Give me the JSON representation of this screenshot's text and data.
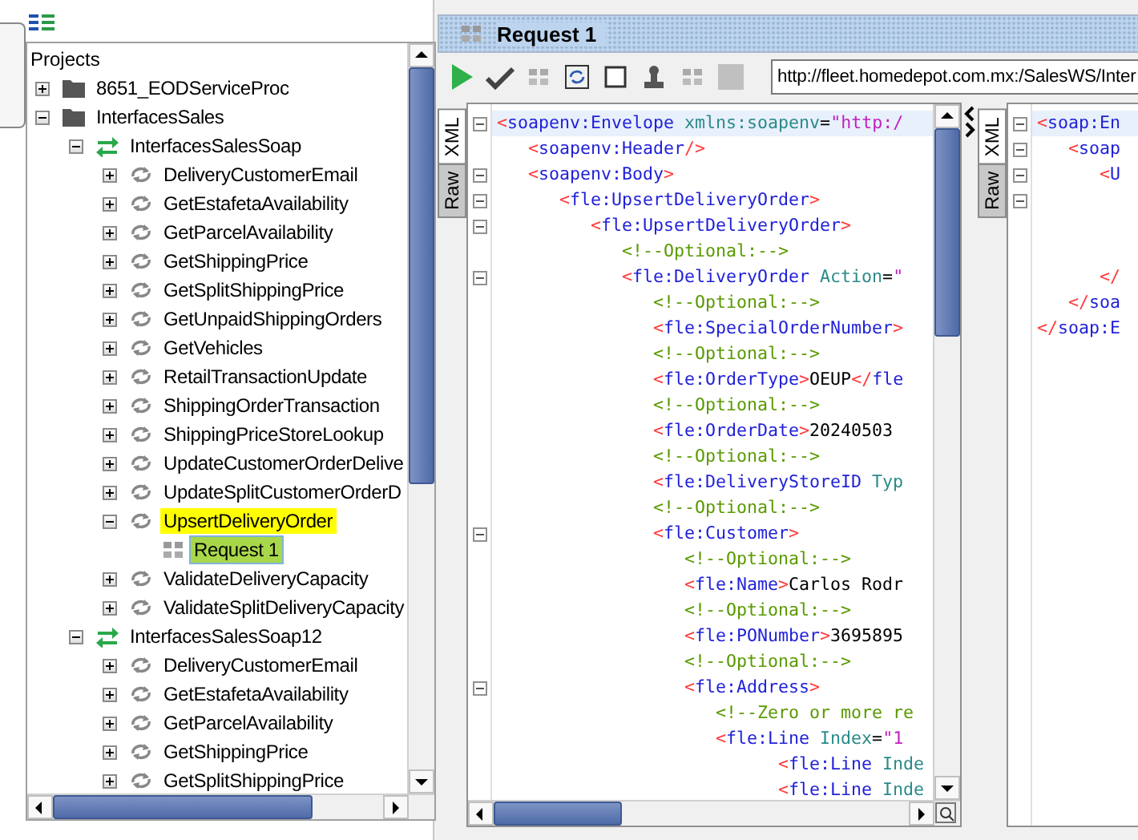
{
  "navigator": {
    "root_label": "Projects",
    "items": [
      {
        "label": "8651_EODServiceProc",
        "kind": "folder",
        "expanded": false,
        "selected": false,
        "highlighted": false
      },
      {
        "label": "InterfacesSales",
        "kind": "folder",
        "expanded": true,
        "selected": false,
        "highlighted": false,
        "children": [
          {
            "label": "InterfacesSalesSoap",
            "kind": "interface",
            "expanded": true,
            "selected": false,
            "highlighted": false,
            "children": [
              {
                "label": "DeliveryCustomerEmail",
                "kind": "operation",
                "expanded": false,
                "selected": false,
                "highlighted": false
              },
              {
                "label": "GetEstafetaAvailability",
                "kind": "operation",
                "expanded": false,
                "selected": false,
                "highlighted": false
              },
              {
                "label": "GetParcelAvailability",
                "kind": "operation",
                "expanded": false,
                "selected": false,
                "highlighted": false
              },
              {
                "label": "GetShippingPrice",
                "kind": "operation",
                "expanded": false,
                "selected": false,
                "highlighted": false
              },
              {
                "label": "GetSplitShippingPrice",
                "kind": "operation",
                "expanded": false,
                "selected": false,
                "highlighted": false
              },
              {
                "label": "GetUnpaidShippingOrders",
                "kind": "operation",
                "expanded": false,
                "selected": false,
                "highlighted": false
              },
              {
                "label": "GetVehicles",
                "kind": "operation",
                "expanded": false,
                "selected": false,
                "highlighted": false
              },
              {
                "label": "RetailTransactionUpdate",
                "kind": "operation",
                "expanded": false,
                "selected": false,
                "highlighted": false
              },
              {
                "label": "ShippingOrderTransaction",
                "kind": "operation",
                "expanded": false,
                "selected": false,
                "highlighted": false
              },
              {
                "label": "ShippingPriceStoreLookup",
                "kind": "operation",
                "expanded": false,
                "selected": false,
                "highlighted": false
              },
              {
                "label": "UpdateCustomerOrderDelive",
                "kind": "operation",
                "expanded": false,
                "selected": false,
                "highlighted": false
              },
              {
                "label": "UpdateSplitCustomerOrderD",
                "kind": "operation",
                "expanded": false,
                "selected": false,
                "highlighted": false
              },
              {
                "label": "UpsertDeliveryOrder",
                "kind": "operation",
                "expanded": true,
                "selected": false,
                "highlighted": true,
                "children": [
                  {
                    "label": "Request 1",
                    "kind": "request",
                    "selected": true,
                    "highlighted": true
                  }
                ]
              },
              {
                "label": "ValidateDeliveryCapacity",
                "kind": "operation",
                "expanded": false,
                "selected": false,
                "highlighted": false
              },
              {
                "label": "ValidateSplitDeliveryCapacity",
                "kind": "operation",
                "expanded": false,
                "selected": false,
                "highlighted": false
              }
            ]
          },
          {
            "label": "InterfacesSalesSoap12",
            "kind": "interface",
            "expanded": true,
            "selected": false,
            "highlighted": false,
            "children": [
              {
                "label": "DeliveryCustomerEmail",
                "kind": "operation",
                "expanded": false,
                "selected": false,
                "highlighted": false
              },
              {
                "label": "GetEstafetaAvailability",
                "kind": "operation",
                "expanded": false,
                "selected": false,
                "highlighted": false
              },
              {
                "label": "GetParcelAvailability",
                "kind": "operation",
                "expanded": false,
                "selected": false,
                "highlighted": false
              },
              {
                "label": "GetShippingPrice",
                "kind": "operation",
                "expanded": false,
                "selected": false,
                "highlighted": false
              },
              {
                "label": "GetSplitShippingPrice",
                "kind": "operation",
                "expanded": false,
                "selected": false,
                "highlighted": false
              }
            ]
          }
        ]
      }
    ]
  },
  "editor_tab": {
    "title": "Request 1"
  },
  "toolbar": {
    "url": "http://fleet.homedepot.com.mx:/SalesWS/Inter"
  },
  "request_pane": {
    "side_tabs": [
      {
        "label": "XML",
        "selected": true
      },
      {
        "label": "Raw",
        "selected": false
      }
    ],
    "lines": [
      {
        "fold": true,
        "current": true,
        "tokens": [
          {
            "kind": "bracket",
            "text": "<"
          },
          {
            "kind": "tag",
            "text": "soapenv:Envelope"
          },
          {
            "kind": "attr",
            "text": " xmlns:soapenv"
          },
          {
            "kind": "plain",
            "text": "="
          },
          {
            "kind": "value",
            "text": "\"http:/"
          }
        ]
      },
      {
        "fold": false,
        "current": false,
        "tokens": [
          {
            "kind": "bracket",
            "text": "   <"
          },
          {
            "kind": "tag",
            "text": "soapenv:Header"
          },
          {
            "kind": "bracket",
            "text": "/>"
          }
        ]
      },
      {
        "fold": true,
        "current": false,
        "tokens": [
          {
            "kind": "bracket",
            "text": "   <"
          },
          {
            "kind": "tag",
            "text": "soapenv:Body"
          },
          {
            "kind": "bracket",
            "text": ">"
          }
        ]
      },
      {
        "fold": true,
        "current": false,
        "tokens": [
          {
            "kind": "bracket",
            "text": "      <"
          },
          {
            "kind": "tag",
            "text": "fle:UpsertDeliveryOrder"
          },
          {
            "kind": "bracket",
            "text": ">"
          }
        ]
      },
      {
        "fold": true,
        "current": false,
        "tokens": [
          {
            "kind": "bracket",
            "text": "         <"
          },
          {
            "kind": "tag",
            "text": "fle:UpsertDeliveryOrder"
          },
          {
            "kind": "bracket",
            "text": ">"
          }
        ]
      },
      {
        "fold": false,
        "current": false,
        "tokens": [
          {
            "kind": "comment",
            "text": "            <!--Optional:-->"
          }
        ]
      },
      {
        "fold": true,
        "current": false,
        "tokens": [
          {
            "kind": "bracket",
            "text": "            <"
          },
          {
            "kind": "tag",
            "text": "fle:DeliveryOrder"
          },
          {
            "kind": "attr",
            "text": " Action"
          },
          {
            "kind": "plain",
            "text": "="
          },
          {
            "kind": "value",
            "text": "\""
          }
        ]
      },
      {
        "fold": false,
        "current": false,
        "tokens": [
          {
            "kind": "comment",
            "text": "               <!--Optional:-->"
          }
        ]
      },
      {
        "fold": false,
        "current": false,
        "tokens": [
          {
            "kind": "bracket",
            "text": "               <"
          },
          {
            "kind": "tag",
            "text": "fle:SpecialOrderNumber"
          },
          {
            "kind": "bracket",
            "text": ">"
          }
        ]
      },
      {
        "fold": false,
        "current": false,
        "tokens": [
          {
            "kind": "comment",
            "text": "               <!--Optional:-->"
          }
        ]
      },
      {
        "fold": false,
        "current": false,
        "tokens": [
          {
            "kind": "bracket",
            "text": "               <"
          },
          {
            "kind": "tag",
            "text": "fle:OrderType"
          },
          {
            "kind": "bracket",
            "text": ">"
          },
          {
            "kind": "plain",
            "text": "OEUP"
          },
          {
            "kind": "bracket",
            "text": "</"
          },
          {
            "kind": "tag",
            "text": "fle"
          }
        ]
      },
      {
        "fold": false,
        "current": false,
        "tokens": [
          {
            "kind": "comment",
            "text": "               <!--Optional:-->"
          }
        ]
      },
      {
        "fold": false,
        "current": false,
        "tokens": [
          {
            "kind": "bracket",
            "text": "               <"
          },
          {
            "kind": "tag",
            "text": "fle:OrderDate"
          },
          {
            "kind": "bracket",
            "text": ">"
          },
          {
            "kind": "plain",
            "text": "20240503"
          }
        ]
      },
      {
        "fold": false,
        "current": false,
        "tokens": [
          {
            "kind": "comment",
            "text": "               <!--Optional:-->"
          }
        ]
      },
      {
        "fold": false,
        "current": false,
        "tokens": [
          {
            "kind": "bracket",
            "text": "               <"
          },
          {
            "kind": "tag",
            "text": "fle:DeliveryStoreID"
          },
          {
            "kind": "attr",
            "text": " Typ"
          }
        ]
      },
      {
        "fold": false,
        "current": false,
        "tokens": [
          {
            "kind": "comment",
            "text": "               <!--Optional:-->"
          }
        ]
      },
      {
        "fold": true,
        "current": false,
        "tokens": [
          {
            "kind": "bracket",
            "text": "               <"
          },
          {
            "kind": "tag",
            "text": "fle:Customer"
          },
          {
            "kind": "bracket",
            "text": ">"
          }
        ]
      },
      {
        "fold": false,
        "current": false,
        "tokens": [
          {
            "kind": "comment",
            "text": "                  <!--Optional:-->"
          }
        ]
      },
      {
        "fold": false,
        "current": false,
        "tokens": [
          {
            "kind": "bracket",
            "text": "                  <"
          },
          {
            "kind": "tag",
            "text": "fle:Name"
          },
          {
            "kind": "bracket",
            "text": ">"
          },
          {
            "kind": "plain",
            "text": "Carlos Rodr"
          }
        ]
      },
      {
        "fold": false,
        "current": false,
        "tokens": [
          {
            "kind": "comment",
            "text": "                  <!--Optional:-->"
          }
        ]
      },
      {
        "fold": false,
        "current": false,
        "tokens": [
          {
            "kind": "bracket",
            "text": "                  <"
          },
          {
            "kind": "tag",
            "text": "fle:PONumber"
          },
          {
            "kind": "bracket",
            "text": ">"
          },
          {
            "kind": "plain",
            "text": "3695895"
          }
        ]
      },
      {
        "fold": false,
        "current": false,
        "tokens": [
          {
            "kind": "comment",
            "text": "                  <!--Optional:-->"
          }
        ]
      },
      {
        "fold": true,
        "current": false,
        "tokens": [
          {
            "kind": "bracket",
            "text": "                  <"
          },
          {
            "kind": "tag",
            "text": "fle:Address"
          },
          {
            "kind": "bracket",
            "text": ">"
          }
        ]
      },
      {
        "fold": false,
        "current": false,
        "tokens": [
          {
            "kind": "comment",
            "text": "                     <!--Zero or more re"
          }
        ]
      },
      {
        "fold": false,
        "current": false,
        "tokens": [
          {
            "kind": "bracket",
            "text": "                     <"
          },
          {
            "kind": "tag",
            "text": "fle:Line"
          },
          {
            "kind": "attr",
            "text": " Index"
          },
          {
            "kind": "plain",
            "text": "="
          },
          {
            "kind": "value",
            "text": "\"1"
          }
        ]
      },
      {
        "fold": false,
        "current": false,
        "tokens": [
          {
            "kind": "bracket",
            "text": "                           <"
          },
          {
            "kind": "tag",
            "text": "fle:Line"
          },
          {
            "kind": "attr",
            "text": " Inde"
          }
        ]
      },
      {
        "fold": false,
        "current": false,
        "tokens": [
          {
            "kind": "bracket",
            "text": "                           <"
          },
          {
            "kind": "tag",
            "text": "fle:Line"
          },
          {
            "kind": "attr",
            "text": " Inde"
          }
        ]
      }
    ]
  },
  "response_pane": {
    "side_tabs": [
      {
        "label": "XML",
        "selected": true
      },
      {
        "label": "Raw",
        "selected": false
      }
    ],
    "lines": [
      {
        "fold": true,
        "current": true,
        "tokens": [
          {
            "kind": "bracket",
            "text": "<"
          },
          {
            "kind": "tag",
            "text": "soap:En"
          }
        ]
      },
      {
        "fold": true,
        "current": false,
        "tokens": [
          {
            "kind": "bracket",
            "text": "   <"
          },
          {
            "kind": "tag",
            "text": "soap"
          }
        ]
      },
      {
        "fold": true,
        "current": false,
        "tokens": [
          {
            "kind": "bracket",
            "text": "      <"
          },
          {
            "kind": "tag",
            "text": "U"
          }
        ]
      },
      {
        "fold": true
      },
      {
        "fold": false
      },
      {
        "fold": false
      },
      {
        "fold": false,
        "current": false,
        "tokens": [
          {
            "kind": "bracket",
            "text": "      </"
          }
        ]
      },
      {
        "fold": false,
        "current": false,
        "tokens": [
          {
            "kind": "bracket",
            "text": "   </"
          },
          {
            "kind": "tag",
            "text": "soa"
          }
        ]
      },
      {
        "fold": false,
        "current": false,
        "tokens": [
          {
            "kind": "bracket",
            "text": "</"
          },
          {
            "kind": "tag",
            "text": "soap:E"
          }
        ]
      }
    ]
  }
}
